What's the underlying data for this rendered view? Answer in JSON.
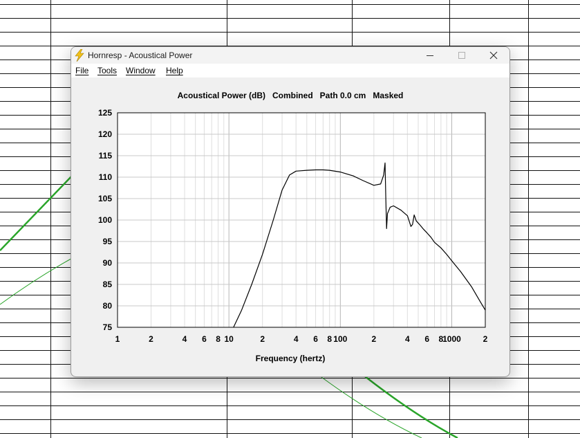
{
  "window": {
    "title": "Hornresp - Acoustical Power",
    "icon": "lightning-icon"
  },
  "menu": [
    "File",
    "Tools",
    "Window",
    "Help"
  ],
  "colors": {
    "background_curve": "#2aa52a",
    "response_curve": "#000000",
    "grid": "#c8c8c8"
  },
  "chart_data": {
    "type": "line",
    "title": "Acoustical Power (dB)   Combined   Path 0.0 cm   Masked",
    "xlabel": "Frequency (hertz)",
    "ylabel": "",
    "xscale": "log",
    "xlim": [
      1,
      2000
    ],
    "ylim": [
      75,
      125
    ],
    "grid": true,
    "yticks": [
      75,
      80,
      85,
      90,
      95,
      100,
      105,
      110,
      115,
      120,
      125
    ],
    "xtick_values": [
      1,
      2,
      4,
      6,
      8,
      10,
      20,
      40,
      60,
      80,
      100,
      200,
      400,
      600,
      800,
      1000,
      2000
    ],
    "xtick_labels": [
      "1",
      "2",
      "4",
      "6",
      "8",
      "10",
      "2",
      "4",
      "6",
      "8",
      "100",
      "2",
      "4",
      "6",
      "8",
      "1000",
      "2"
    ],
    "series": [
      {
        "x": [
          11,
          13,
          16,
          20,
          25,
          30,
          35,
          40,
          45,
          50,
          60,
          70,
          80,
          100,
          130,
          160,
          200,
          230,
          245,
          252,
          256,
          260,
          265,
          280,
          300,
          350,
          400,
          430,
          445,
          460,
          480,
          520,
          560,
          600,
          650,
          700,
          800,
          900,
          1000,
          1200,
          1500,
          1800,
          2000
        ],
        "y": [
          75,
          79,
          85,
          92,
          100,
          107,
          110.5,
          111.4,
          111.5,
          111.6,
          111.7,
          111.7,
          111.6,
          111.2,
          110.3,
          109.2,
          108.1,
          108.4,
          110.5,
          113.3,
          105,
          98,
          101.5,
          103,
          103.3,
          102.3,
          101,
          98.5,
          99,
          101.2,
          99.8,
          98.8,
          97.8,
          97,
          96,
          94.8,
          93.5,
          92,
          90.5,
          88,
          84.5,
          81,
          79
        ]
      }
    ]
  }
}
